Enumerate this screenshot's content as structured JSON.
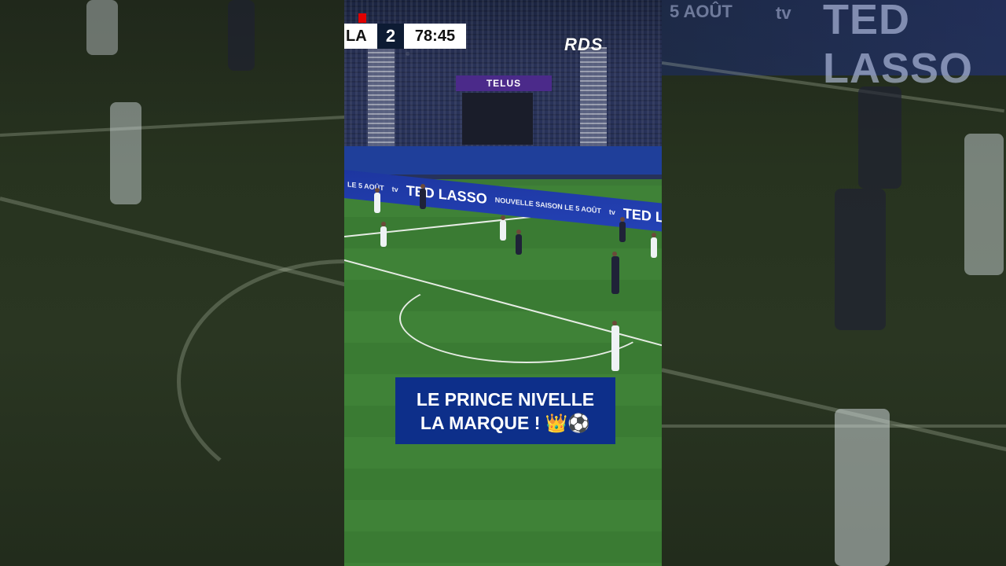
{
  "scoreboard": {
    "team": "LA",
    "goals": "2",
    "clock": "78:45"
  },
  "broadcaster": "RDS",
  "stadium_sign": "TELUS",
  "boards": {
    "text_1": "LE 5 AOÛT",
    "apple_tv": "tv",
    "main": "TED LASSO",
    "sub": "NOUVELLE SAISON LE 5 AOÛT",
    "apple_tv_2": "tv",
    "main_2": "TED LASSO"
  },
  "blurred_board": {
    "text_1": "5 AOÛT",
    "apple_tv": "tv",
    "main": "TED LASSO"
  },
  "caption": {
    "line1": "LE PRINCE NIVELLE",
    "line2": "LA MARQUE ! 👑⚽"
  },
  "colors": {
    "caption_bg": "#0d2f8a",
    "scoreboard_dark": "#0d1b33",
    "red_card": "#e00000",
    "pitch": "#3c7a36"
  }
}
